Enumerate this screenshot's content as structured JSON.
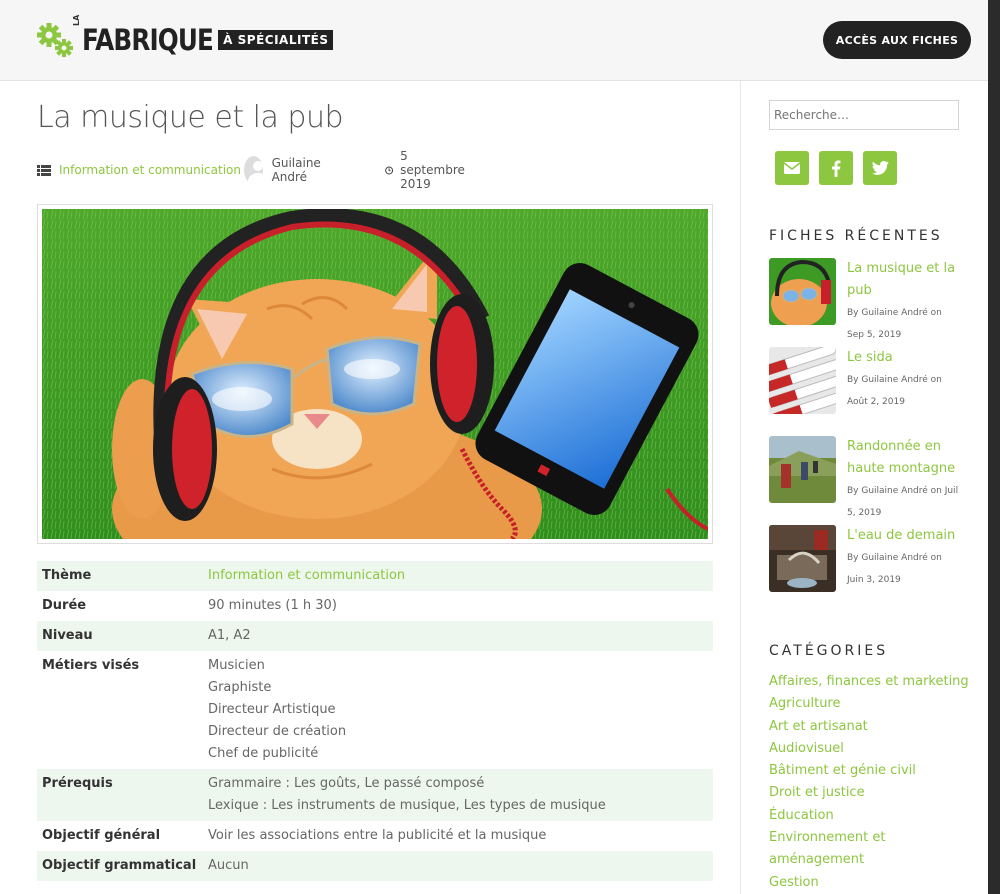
{
  "header": {
    "logo_prefix": "LA",
    "logo_main": "FABRIQUE",
    "logo_tag": "À SPÉCIALITÉS",
    "cta_label": "ACCÈS AUX FICHES"
  },
  "article": {
    "title": "La musique et la pub",
    "category": "Information et communication",
    "author": "Guilaine André",
    "date": "5 septembre 2019",
    "details": [
      {
        "key": "Thème",
        "values": [
          "Information et communication"
        ],
        "link": true
      },
      {
        "key": "Durée",
        "values": [
          "90 minutes (1 h 30)"
        ]
      },
      {
        "key": "Niveau",
        "values": [
          "A1, A2"
        ]
      },
      {
        "key": "Métiers visés",
        "values": [
          "Musicien",
          "Graphiste",
          "Directeur Artistique",
          "Directeur de création",
          "Chef de publicité"
        ]
      },
      {
        "key": "Prérequis",
        "values": [
          "Grammaire : Les goûts, Le passé composé",
          "Lexique : Les instruments de musique, Les types de musique"
        ]
      },
      {
        "key": "Objectif général",
        "values": [
          "Voir les associations entre la publicité et la musique"
        ]
      },
      {
        "key": "Objectif grammatical",
        "values": [
          "Aucun"
        ]
      }
    ]
  },
  "sidebar": {
    "search_placeholder": "Recherche…",
    "social": [
      "email-icon",
      "facebook-icon",
      "twitter-icon"
    ],
    "recent_title": "FICHES RÉCENTES",
    "recent": [
      {
        "title": "La musique et la pub",
        "byline": "By Guilaine André on Sep 5, 2019"
      },
      {
        "title": "Le sida",
        "byline": "By Guilaine André on Août 2, 2019"
      },
      {
        "title": "Randonnée en haute montagne",
        "byline": "By Guilaine André on Juil 5, 2019"
      },
      {
        "title": "L'eau de demain",
        "byline": "By Guilaine André on Juin 3, 2019"
      }
    ],
    "categories_title": "CATÉGORIES",
    "categories": [
      "Affaires, finances et marketing",
      "Agriculture",
      "Art et artisanat",
      "Audiovisuel",
      "Bâtiment et génie civil",
      "Droit et justice",
      "Éducation",
      "Environnement et aménagement",
      "Gestion"
    ]
  },
  "colors": {
    "accent": "#8dc63f",
    "dark": "#222222",
    "row_alt": "#eef7ee"
  }
}
